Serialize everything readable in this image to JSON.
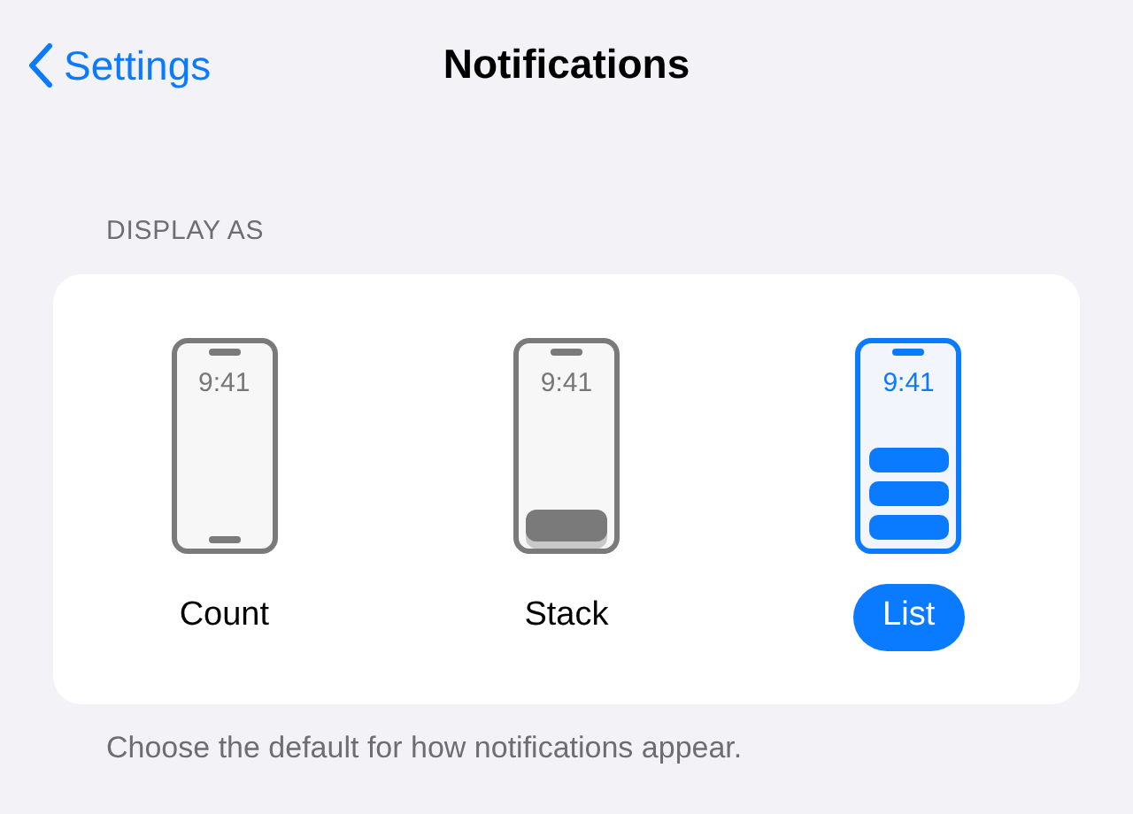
{
  "nav": {
    "back_label": "Settings",
    "title": "Notifications"
  },
  "section": {
    "header": "DISPLAY AS",
    "options": [
      {
        "kind": "count",
        "time": "9:41",
        "label": "Count",
        "selected": false
      },
      {
        "kind": "stack",
        "time": "9:41",
        "label": "Stack",
        "selected": false
      },
      {
        "kind": "list",
        "time": "9:41",
        "label": "List",
        "selected": true
      }
    ],
    "footer": "Choose the default for how notifications appear."
  }
}
